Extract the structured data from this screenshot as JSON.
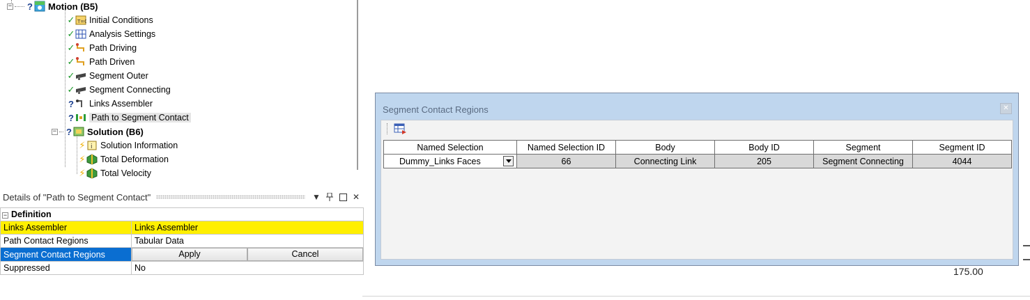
{
  "tree": {
    "motion": {
      "label": "Motion (B5)",
      "status": "?"
    },
    "motion_children": [
      {
        "label": "Initial Conditions",
        "status": "✓",
        "icon": "initial-conditions-icon"
      },
      {
        "label": "Analysis Settings",
        "status": "✓",
        "icon": "analysis-settings-icon"
      },
      {
        "label": "Path Driving",
        "status": "✓",
        "icon": "path-icon"
      },
      {
        "label": "Path Driven",
        "status": "✓",
        "icon": "path-icon"
      },
      {
        "label": "Segment Outer",
        "status": "✓",
        "icon": "segment-icon"
      },
      {
        "label": "Segment Connecting",
        "status": "✓",
        "icon": "segment-icon"
      },
      {
        "label": "Links Assembler",
        "status": "?",
        "icon": "links-assembler-icon"
      },
      {
        "label": "Path to Segment Contact",
        "status": "?",
        "icon": "contact-icon"
      }
    ],
    "solution": {
      "label": "Solution (B6)",
      "status": "?"
    },
    "solution_children": [
      {
        "label": "Solution Information",
        "status": "⚡",
        "icon": "solution-information-icon"
      },
      {
        "label": "Total Deformation",
        "status": "⚡",
        "icon": "result-icon"
      },
      {
        "label": "Total Velocity",
        "status": "⚡",
        "icon": "result-icon"
      }
    ]
  },
  "details": {
    "title": "Details of \"Path to Segment Contact\"",
    "section": "Definition",
    "rows": [
      {
        "key": "Links Assembler",
        "value": "Links Assembler"
      },
      {
        "key": "Path Contact Regions",
        "value": "Tabular Data"
      },
      {
        "key": "Segment Contact Regions",
        "apply": "Apply",
        "cancel": "Cancel"
      },
      {
        "key": "Suppressed",
        "value": "No"
      }
    ]
  },
  "dialog": {
    "title": "Segment Contact Regions",
    "columns": [
      "Named Selection",
      "Named Selection ID",
      "Body",
      "Body ID",
      "Segment",
      "Segment ID"
    ],
    "rows": [
      [
        "Dummy_Links Faces",
        "66",
        "Connecting Link",
        "205",
        "Segment Connecting",
        "4044"
      ]
    ]
  },
  "background_value": "175.00",
  "colors": {
    "highlight_yellow": "#ffef00",
    "selection_blue": "#0a6ed1",
    "dialog_frame": "#bfd6ee",
    "ok_green": "#1d9a2a"
  }
}
